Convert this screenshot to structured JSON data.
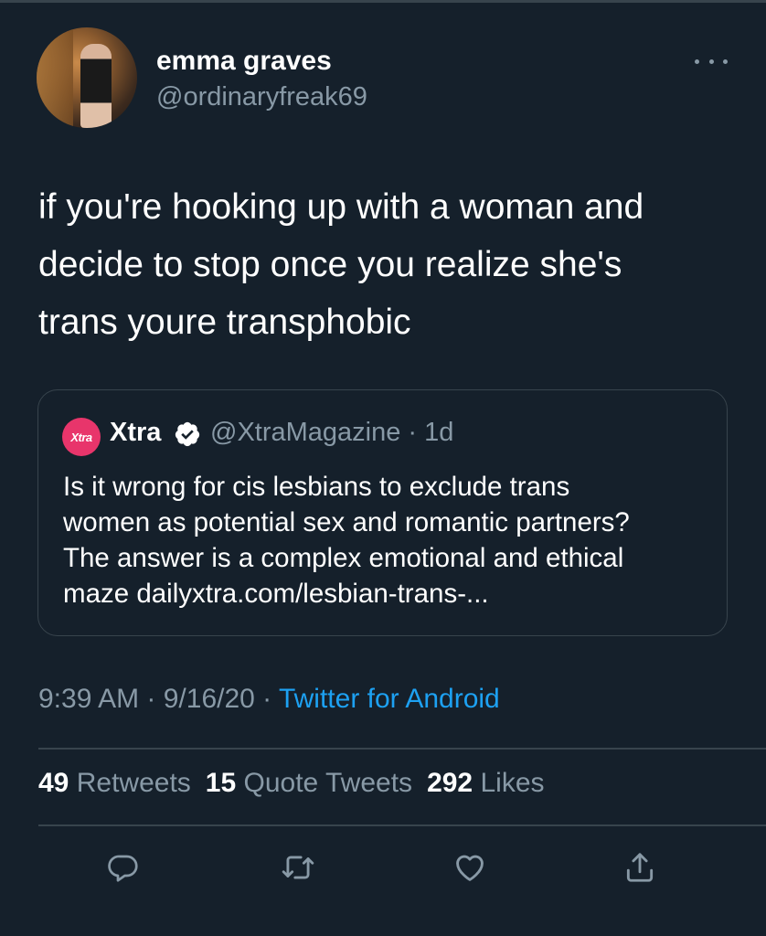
{
  "author": {
    "display_name": "emma graves",
    "handle": "@ordinaryfreak69"
  },
  "tweet": {
    "text": "if you're hooking up with a woman and\ndecide to stop once you realize she's\ntrans youre transphobic"
  },
  "quoted_tweet": {
    "avatar_text": "Xtra",
    "display_name": "Xtra",
    "verified": true,
    "handle_time": "@XtraMagazine · 1d",
    "text": "Is it wrong for cis lesbians to exclude trans\nwomen as potential sex and romantic partners?\nThe answer is a complex emotional and ethical\nmaze dailyxtra.com/lesbian-trans-...",
    "accent_color": "#e8356b"
  },
  "meta": {
    "time": "9:39 AM",
    "separator1": " · ",
    "date": "9/16/20",
    "separator2": " · ",
    "source": "Twitter for Android"
  },
  "stats": {
    "retweets_count": "49",
    "retweets_label": "Retweets",
    "quotes_count": "15",
    "quotes_label": "Quote Tweets",
    "likes_count": "292",
    "likes_label": "Likes"
  },
  "actions": {
    "reply_icon": "reply-icon",
    "retweet_icon": "retweet-icon",
    "like_icon": "heart-icon",
    "share_icon": "share-icon"
  },
  "colors": {
    "background": "#15202b",
    "secondary_text": "#8899a6",
    "link": "#1da1f2",
    "border": "#38444d"
  }
}
